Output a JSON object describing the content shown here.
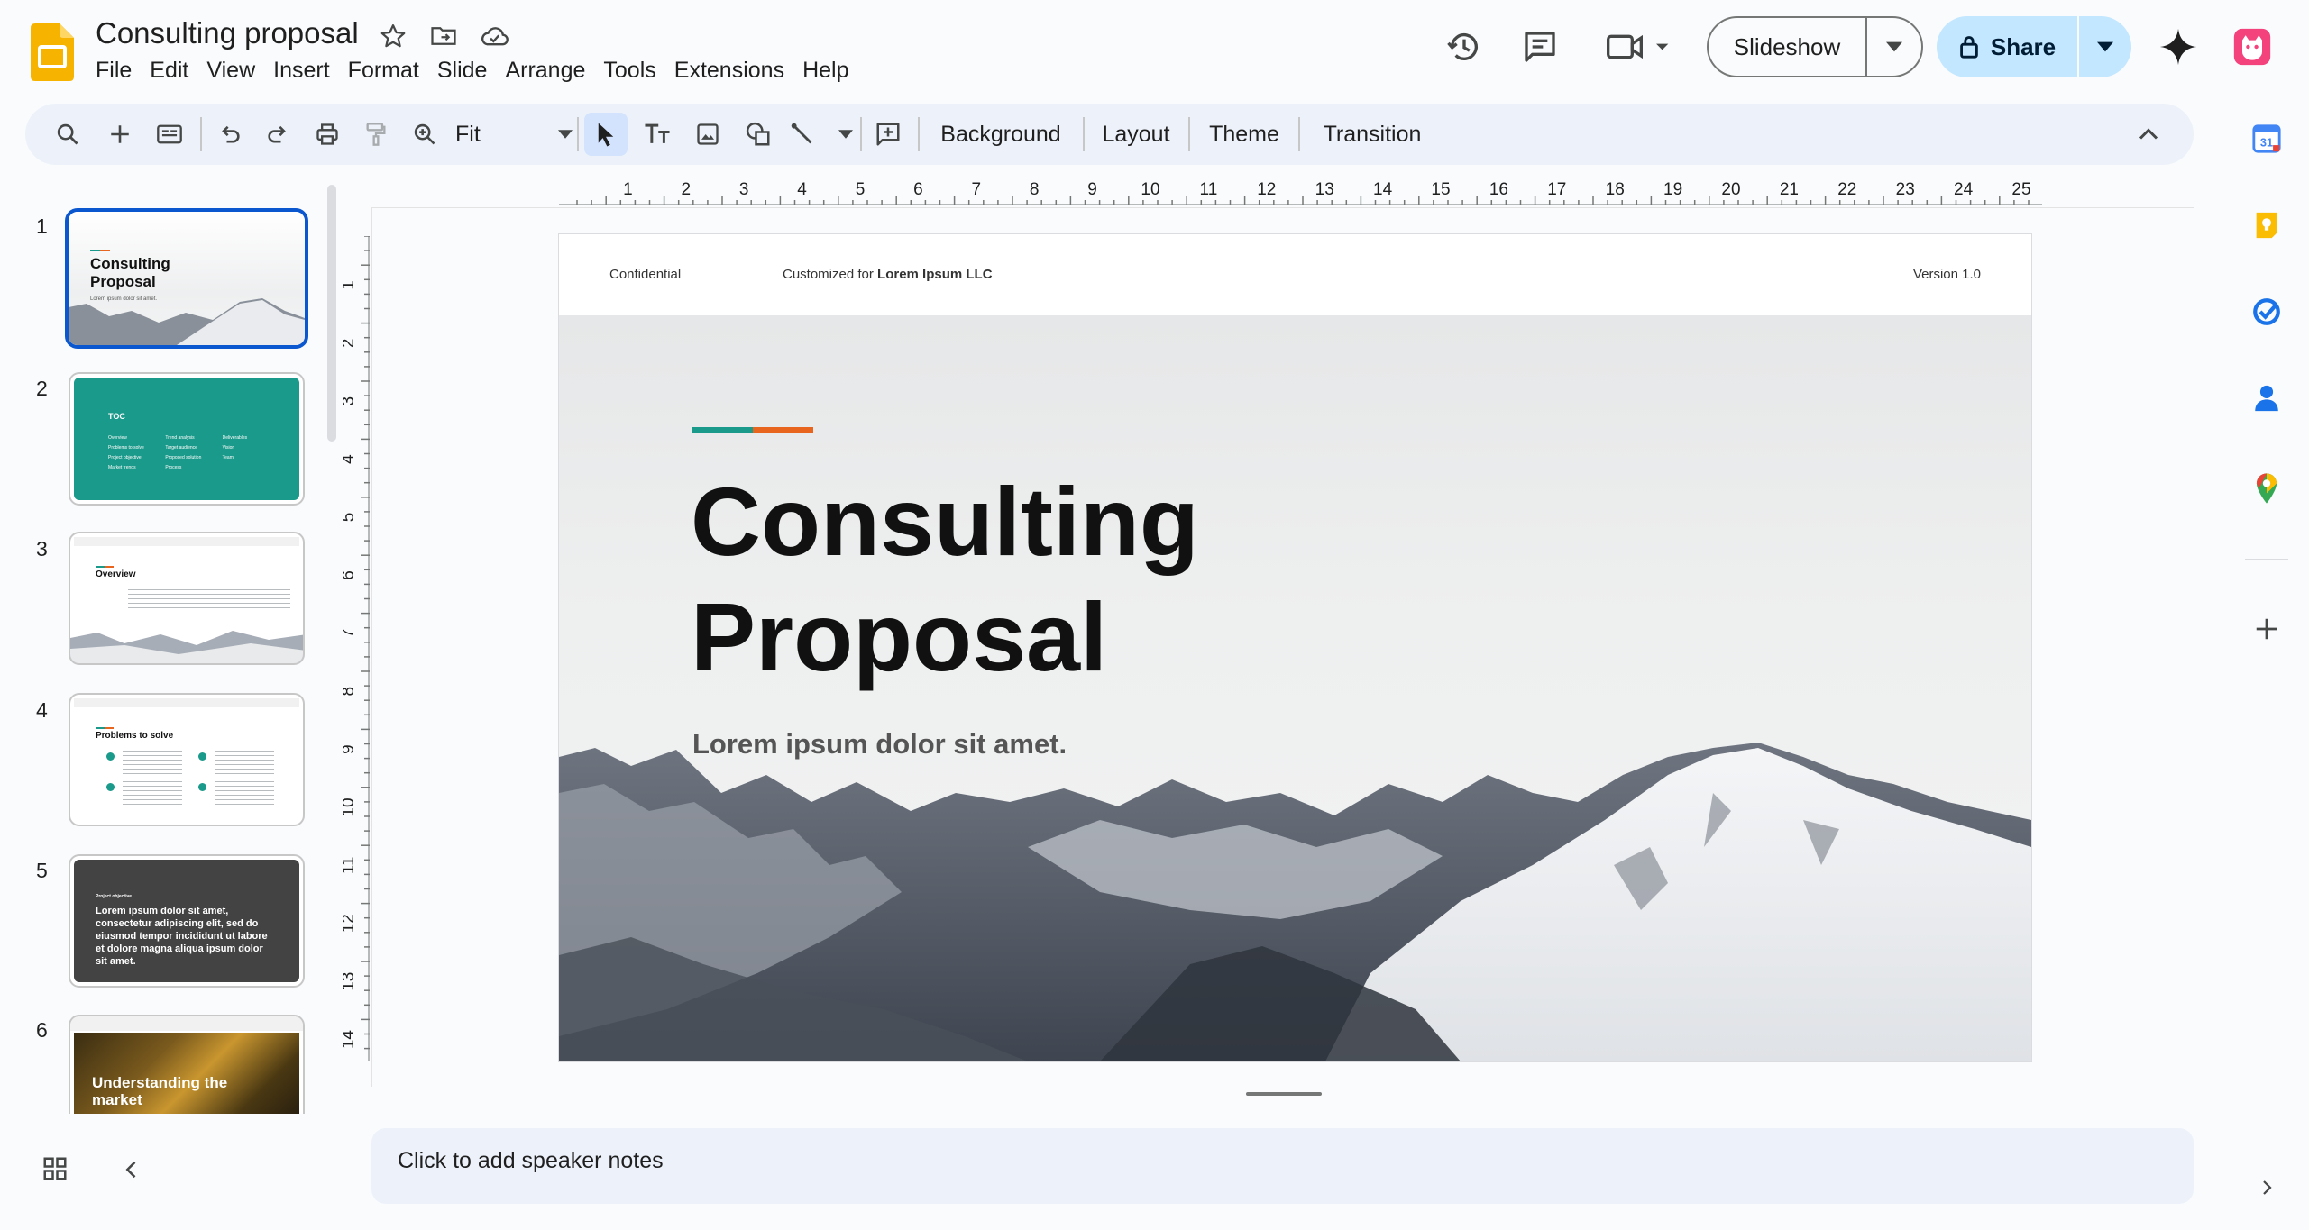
{
  "app": {
    "title": "Consulting proposal",
    "menu": [
      "File",
      "Edit",
      "View",
      "Insert",
      "Format",
      "Slide",
      "Arrange",
      "Tools",
      "Extensions",
      "Help"
    ],
    "slideshow_label": "Slideshow",
    "share_label": "Share",
    "brand_color": "#f6b400",
    "accent_color": "#0b57d0"
  },
  "toolbar": {
    "zoom_value": "Fit",
    "background_label": "Background",
    "layout_label": "Layout",
    "theme_label": "Theme",
    "transition_label": "Transition"
  },
  "filmstrip": {
    "slides": [
      {
        "num": "1",
        "title": "Consulting Proposal",
        "sub": "Lorem ipsum dolor sit amet.",
        "style": "white-mountain"
      },
      {
        "num": "2",
        "title": "TOC",
        "style": "teal",
        "items": [
          "Overview",
          "Problems to solve",
          "Project objective",
          "Market trends",
          "Trend analysis",
          "Target audience",
          "Proposed solution",
          "Process",
          "Deliverables",
          "Vision",
          "Team"
        ]
      },
      {
        "num": "3",
        "title": "Overview",
        "style": "white-mountain-bottom"
      },
      {
        "num": "4",
        "title": "Problems to solve",
        "style": "white-bullets"
      },
      {
        "num": "5",
        "title": "Project objective",
        "body": "Lorem ipsum dolor sit amet, consectetur adipiscing elit, sed do eiusmod tempor incididunt ut labore et dolore magna aliqua ipsum dolor sit amet.",
        "style": "dark"
      },
      {
        "num": "6",
        "title": "Understanding the market",
        "style": "photo"
      }
    ]
  },
  "slide": {
    "confidential": "Confidential",
    "customized_prefix": "Customized for ",
    "customized_client": "Lorem Ipsum LLC",
    "version": "Version 1.0",
    "title_line1": "Consulting",
    "title_line2": "Proposal",
    "subtitle": "Lorem ipsum dolor sit amet.",
    "accent_teal": "#1a9a8a",
    "accent_orange": "#e8651f"
  },
  "rulers": {
    "top_labels": [
      "1",
      "2",
      "3",
      "4",
      "5",
      "6",
      "7",
      "8",
      "9",
      "10",
      "11",
      "12",
      "13",
      "14",
      "15",
      "16",
      "17",
      "18",
      "19",
      "20",
      "21",
      "22",
      "23",
      "24",
      "25"
    ],
    "left_labels": [
      "1",
      "2",
      "3",
      "4",
      "5",
      "6",
      "7",
      "8",
      "9",
      "10",
      "11",
      "12",
      "13",
      "14"
    ]
  },
  "notes": {
    "placeholder": "Click to add speaker notes"
  },
  "side_panel": {
    "icons": [
      "calendar-icon",
      "keep-icon",
      "tasks-icon",
      "contacts-icon",
      "maps-icon",
      "add-icon"
    ]
  }
}
